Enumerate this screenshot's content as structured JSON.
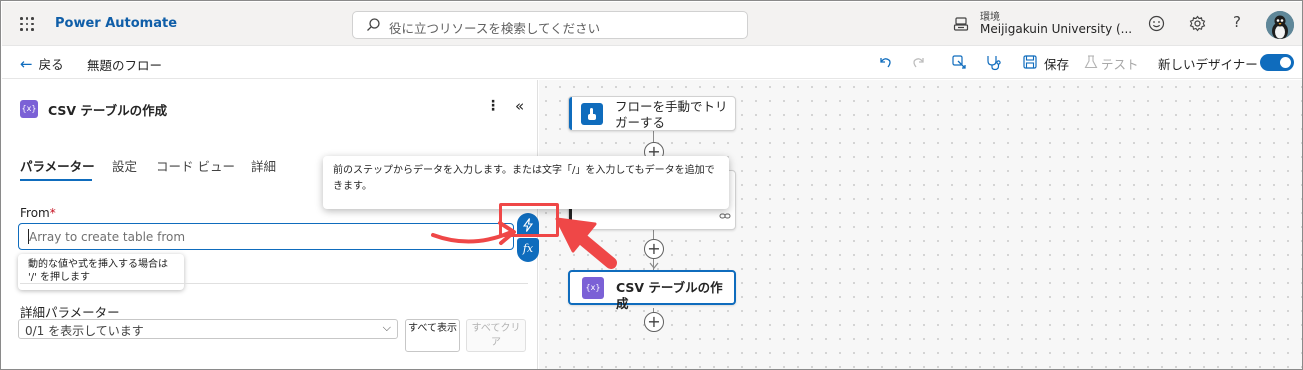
{
  "app": {
    "name": "Power Automate"
  },
  "search": {
    "placeholder": "役に立つリソースを検索してください"
  },
  "environment": {
    "label": "環境",
    "name": "Meijigakuin University (..."
  },
  "toolbar": {
    "back_label": "戻る",
    "flow_name": "無題のフロー",
    "save_label": "保存",
    "test_label": "テスト",
    "new_designer_label": "新しいデザイナー",
    "new_designer_on": true
  },
  "panel": {
    "title": "CSV テーブルの作成",
    "action_icon": "{x}",
    "tabs": [
      {
        "label": "パラメーター",
        "active": true
      },
      {
        "label": "設定",
        "active": false
      },
      {
        "label": "コード ビュー",
        "active": false
      },
      {
        "label": "詳細",
        "active": false
      }
    ],
    "from": {
      "label": "From",
      "required_mark": "*",
      "placeholder": "Array to create table from"
    },
    "hint": "動的な値や式を挿入する場合は '/' を押します",
    "dynamic_button_icon": "lightning-icon",
    "fx_button_label": "fx",
    "advanced": {
      "label": "詳細パラメーター",
      "selected": "0/1 を表示しています",
      "show_all": "すべて表示",
      "clear_all": "すべてクリア"
    }
  },
  "canvas": {
    "nodes": [
      {
        "label": "フローを手動でトリガーする",
        "icon": "hand-touch-icon",
        "color": "#0f6cbd"
      },
      {
        "label": "",
        "icon": "",
        "color": "#242424"
      },
      {
        "label": "CSV テーブルの作成",
        "icon": "{x}",
        "color": "#7b61d6"
      }
    ],
    "tooltip": "前のステップからデータを入力します。または文字「/」を入力してもデータを追加できます。"
  },
  "colors": {
    "brand": "#0f5ea8",
    "accent": "#0f6cbd",
    "action_purple": "#7b61d6",
    "annotation_red": "#ef4747"
  }
}
